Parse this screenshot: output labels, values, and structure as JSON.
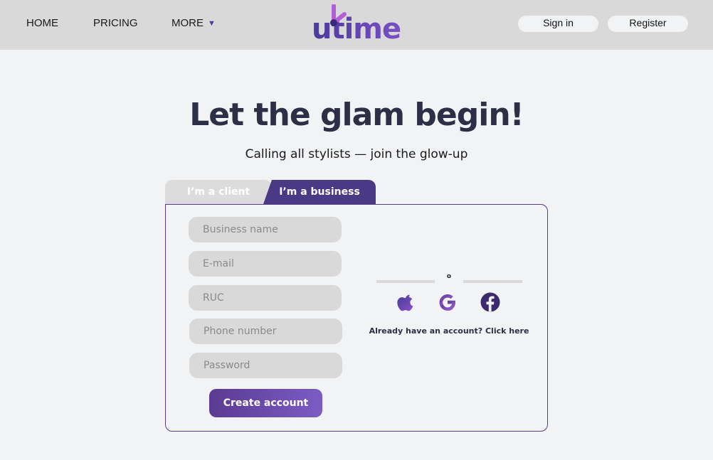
{
  "nav": {
    "home": "HOME",
    "pricing": "PRICING",
    "more": "MORE",
    "more_caret": "▼"
  },
  "logo": {
    "text": "utime",
    "icon": "clock-hand-logo",
    "colors": [
      "#4b3a9b",
      "#b15fd6"
    ]
  },
  "auth": {
    "signin": "Sign in",
    "register": "Register"
  },
  "hero": {
    "title": "Let the glam begin!",
    "subtitle": "Calling all stylists — join the glow-up"
  },
  "tabs": {
    "client": "I’m a client",
    "business": "I’m a business",
    "active": "business"
  },
  "form": {
    "business_name_placeholder": "Business name",
    "email_placeholder": "E-mail",
    "ruc_placeholder": "RUC",
    "phone_placeholder": "Phone number",
    "password_placeholder": "Password",
    "submit": "Create account"
  },
  "social": {
    "divider_text": "o",
    "icons": [
      "apple-icon",
      "google-icon",
      "facebook-icon"
    ],
    "already": "Already have an account? Click here"
  },
  "colors": {
    "accent": "#4a3a85",
    "accent_light": "#7b5cc3",
    "topbar": "#d9d9d9",
    "background": "#f2f3f5"
  }
}
